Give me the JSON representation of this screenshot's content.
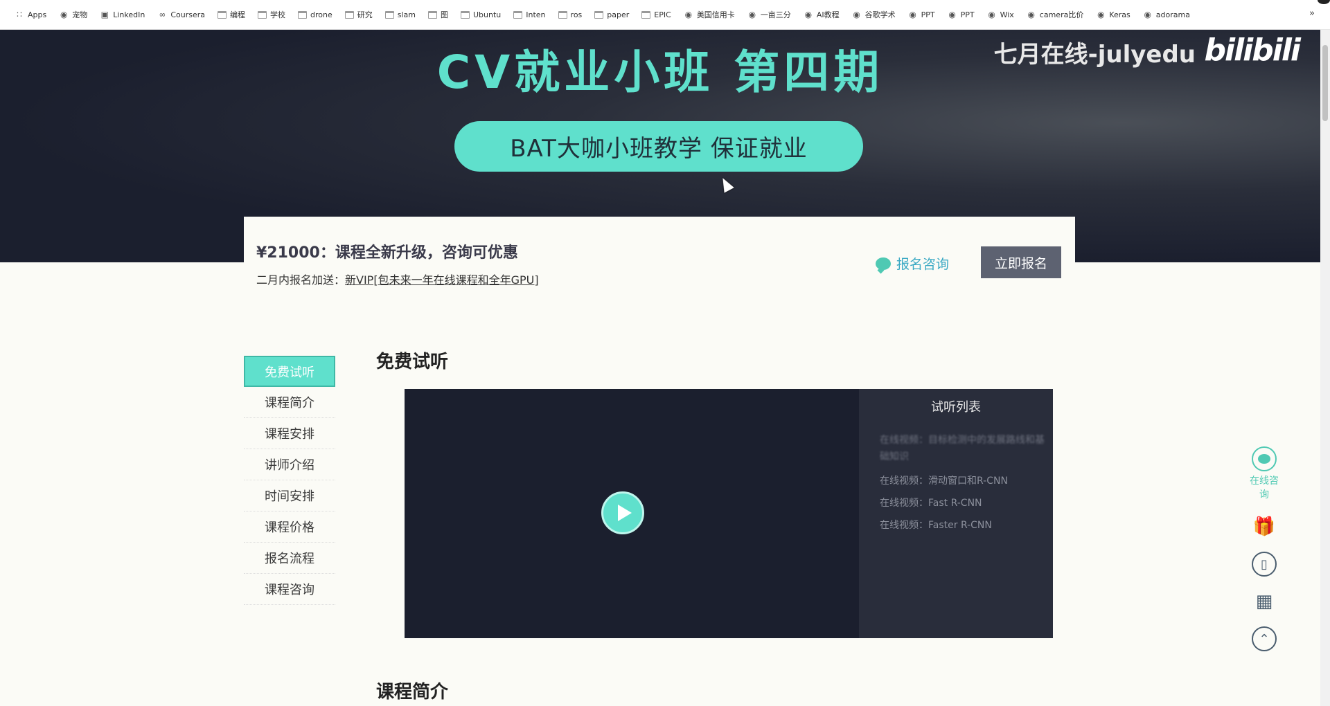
{
  "bookmarks": [
    {
      "label": "Apps",
      "icon": "apps-grid-icon"
    },
    {
      "label": "宠物",
      "icon": "site-icon"
    },
    {
      "label": "LinkedIn",
      "icon": "linkedin-icon"
    },
    {
      "label": "Coursera",
      "icon": "coursera-icon"
    },
    {
      "label": "编程",
      "icon": "folder-icon"
    },
    {
      "label": "学校",
      "icon": "folder-icon"
    },
    {
      "label": "drone",
      "icon": "folder-icon"
    },
    {
      "label": "研究",
      "icon": "folder-icon"
    },
    {
      "label": "slam",
      "icon": "folder-icon"
    },
    {
      "label": "图",
      "icon": "folder-icon"
    },
    {
      "label": "Ubuntu",
      "icon": "folder-icon"
    },
    {
      "label": "Inten",
      "icon": "folder-icon"
    },
    {
      "label": "ros",
      "icon": "folder-icon"
    },
    {
      "label": "paper",
      "icon": "folder-icon"
    },
    {
      "label": "EPIC",
      "icon": "folder-icon"
    },
    {
      "label": "美国信用卡",
      "icon": "site-icon"
    },
    {
      "label": "一亩三分",
      "icon": "site-icon"
    },
    {
      "label": "AI教程",
      "icon": "site-icon"
    },
    {
      "label": "谷歌学术",
      "icon": "site-icon"
    },
    {
      "label": "PPT",
      "icon": "site-icon"
    },
    {
      "label": "PPT",
      "icon": "site-icon"
    },
    {
      "label": "Wix",
      "icon": "site-icon"
    },
    {
      "label": "camera比价",
      "icon": "site-icon"
    },
    {
      "label": "Keras",
      "icon": "site-icon"
    },
    {
      "label": "adorama",
      "icon": "site-icon"
    }
  ],
  "bookmarks_more": "»",
  "hero": {
    "title": "CV就业小班 第四期",
    "brand": "七月在线-julyedu",
    "bili": "bilibili",
    "pill": "BAT大咖小班教学  保证就业"
  },
  "price_card": {
    "title": "¥21000：课程全新升级，咨询可优惠",
    "sub_prefix": "二月内报名加送：",
    "sub_link": "新VIP[包未来一年在线课程和全年GPU]",
    "consult_label": "报名咨询",
    "enroll_label": "立即报名"
  },
  "left_nav": [
    {
      "label": "免费试听",
      "active": true
    },
    {
      "label": "课程简介",
      "active": false
    },
    {
      "label": "课程安排",
      "active": false
    },
    {
      "label": "讲师介绍",
      "active": false
    },
    {
      "label": "时间安排",
      "active": false
    },
    {
      "label": "课程价格",
      "active": false
    },
    {
      "label": "报名流程",
      "active": false
    },
    {
      "label": "课程咨询",
      "active": false
    }
  ],
  "sections": {
    "free_trial": "免费试听",
    "intro": "课程简介"
  },
  "playlist": {
    "title": "试听列表",
    "items": [
      "在线视频：目标检测中的发展路线和基础知识",
      "在线视频：滑动窗口和R-CNN",
      "在线视频：Fast R-CNN",
      "在线视频：Faster R-CNN"
    ]
  },
  "float_tools": {
    "consult_label": "在线咨询"
  },
  "colors": {
    "accent": "#5fe0cc",
    "hero_bg": "#1b1f2e",
    "enroll_btn": "#5d6271",
    "consult_text": "#3aa9c4"
  }
}
